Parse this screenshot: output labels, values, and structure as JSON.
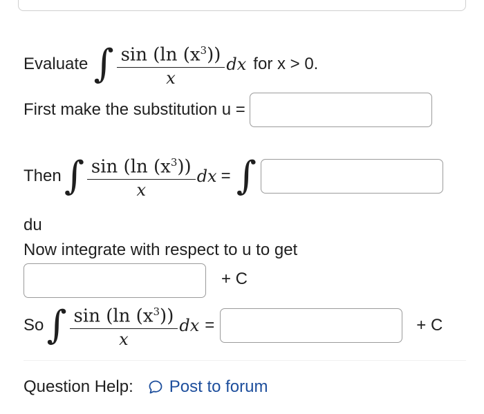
{
  "problem": {
    "evaluate_label": "Evaluate",
    "integrand_numerator": "sin (ln (x",
    "integrand_exponent": "3",
    "integrand_close": "))",
    "integrand_denominator": "x",
    "dx": "dx",
    "condition": "for x > 0."
  },
  "step1": {
    "label": "First make the substitution u =",
    "input_value": ""
  },
  "step2": {
    "label": "Then",
    "equals": "=",
    "input_value": "",
    "trailing": "du"
  },
  "step3": {
    "label": "Now integrate with respect to u to get",
    "input_value": "",
    "constant": "+ C"
  },
  "step4": {
    "label": "So",
    "equals": "=",
    "input_value": "",
    "constant": "+ C"
  },
  "help": {
    "label": "Question Help:",
    "link_text": "Post to forum",
    "link_icon": "speech-bubble-icon",
    "link_color": "#1d4e9c"
  }
}
